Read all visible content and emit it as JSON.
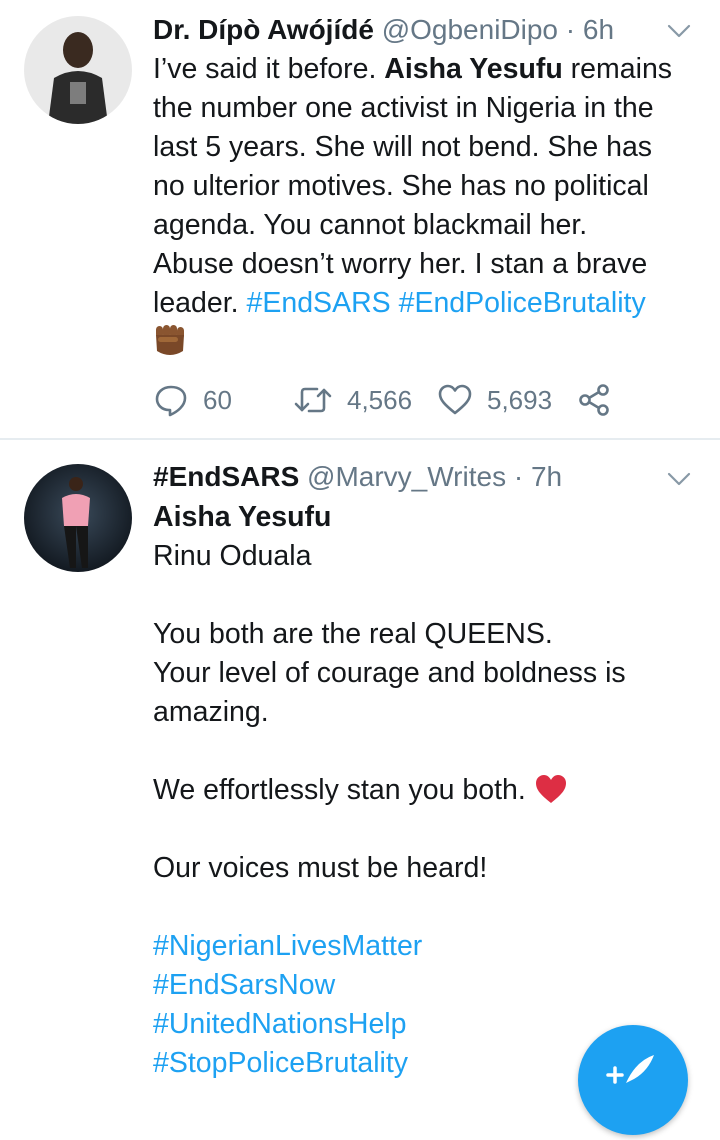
{
  "tweets": [
    {
      "author_name": "Dr. Dípò Awójídé",
      "handle": "@OgbeniDipo",
      "separator": "·",
      "time": "6h",
      "lines": {
        "l1a": "I’ve said it before. ",
        "l1b": "Aisha Yesufu",
        "l1c": " remains",
        "l2": "the number one activist in Nigeria in the",
        "l3": "last 5 years. She will not bend. She has",
        "l4": "no ulterior motives. She has no political",
        "l5": "agenda. You cannot blackmail her.",
        "l6": "Abuse doesn’t worry her. I stan a brave",
        "l7a": "leader. ",
        "l7b": "#EndSARS",
        "l7c": " ",
        "l7d": "#EndPoliceBrutality"
      },
      "emoji": "raised-fist-emoji",
      "stats": {
        "replies": "60",
        "retweets": "4,566",
        "likes": "5,693"
      }
    },
    {
      "author_name": "#EndSARS",
      "handle": "@Marvy_Writes",
      "separator": "·",
      "time": "7h",
      "lines": {
        "l1": "Aisha Yesufu",
        "l2": "Rinu Oduala",
        "l3": "You both are the real QUEENS.",
        "l4": "Your level of courage and boldness is",
        "l5": "amazing.",
        "l6": "We effortlessly stan you both. ",
        "l7": "Our voices must be heard!",
        "t1": "#NigerianLivesMatter",
        "t2": "#EndSarsNow",
        "t3": "#UnitedNationsHelp",
        "t4": "#StopPoliceBrutality"
      },
      "emoji": "red-heart-emoji"
    }
  ],
  "colors": {
    "accent": "#1da1f2",
    "text": "#14171a",
    "secondary": "#657786",
    "divider": "#e6ecf0"
  },
  "icons": [
    "reply-icon",
    "retweet-icon",
    "like-icon",
    "share-icon",
    "chevron-down-icon",
    "compose-icon"
  ]
}
